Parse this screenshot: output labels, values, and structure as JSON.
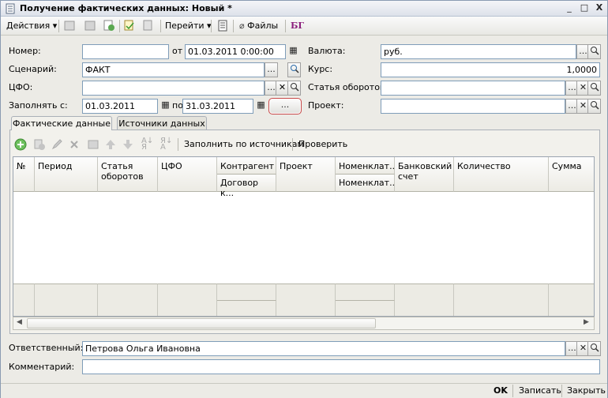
{
  "window": {
    "title": "Получение фактических данных: Новый *",
    "minimize": "_",
    "maximize": "□",
    "close": "X"
  },
  "toolbar": {
    "actions": "Действия",
    "goto": "Перейти",
    "files": "Файлы"
  },
  "form": {
    "number_label": "Номер:",
    "number_value": "",
    "from_label": "от",
    "date_value": "01.03.2011  0:00:00",
    "scenario_label": "Сценарий:",
    "scenario_value": "ФАКТ",
    "cfo_label": "ЦФО:",
    "cfo_value": "",
    "fill_from_label": "Заполнять с:",
    "fill_from_value": "01.03.2011",
    "fill_to_label": "по",
    "fill_to_value": "31.03.2011",
    "currency_label": "Валюта:",
    "currency_value": "руб.",
    "rate_label": "Курс:",
    "rate_value": "1,0000",
    "turnover_label": "Статья оборотов:",
    "turnover_value": "",
    "project_label": "Проект:",
    "project_value": "",
    "responsible_label": "Ответственный:",
    "responsible_value": "Петрова Ольга Ивановна",
    "comment_label": "Комментарий:",
    "comment_value": ""
  },
  "buttons": {
    "ellipsis": "...",
    "clear": "✕",
    "search": "🔍",
    "period_button": "..."
  },
  "tabs": [
    {
      "label": "Фактические данные"
    },
    {
      "label": "Источники данных"
    }
  ],
  "grid_toolbar": {
    "fill_by_sources": "Заполнить по источникам",
    "check": "Проверить"
  },
  "grid_columns": {
    "num": "№",
    "period": "Период",
    "turnover": "Статья оборотов",
    "cfo": "ЦФО",
    "counterparty": "Контрагент",
    "contract": "Договор к...",
    "project": "Проект",
    "nomen1": "Номенклат...",
    "nomen2": "Номенклат...",
    "bank_account": "Банковский счет",
    "quantity": "Количество",
    "amount": "Сумма"
  },
  "footer": {
    "ok": "OK",
    "save": "Записать",
    "close": "Закрыть"
  },
  "colors": {
    "accent": "#2a6aa8",
    "brand_mark": "#8a1c7c"
  }
}
